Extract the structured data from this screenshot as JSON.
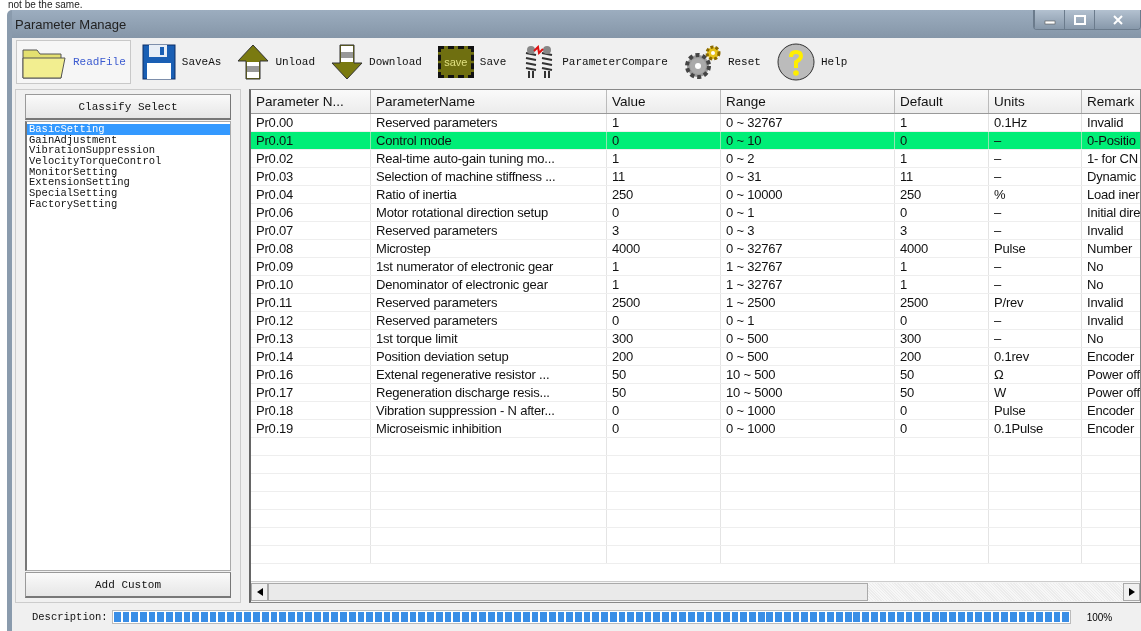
{
  "background_text": "not be the same.",
  "window": {
    "title": "Parameter Manage"
  },
  "toolbar": [
    {
      "kind": "folder",
      "label": "ReadFile",
      "selected": true
    },
    {
      "kind": "floppy",
      "label": "SaveAs",
      "selected": false
    },
    {
      "kind": "up",
      "label": "Unload",
      "selected": false
    },
    {
      "kind": "down",
      "label": "Download",
      "selected": false
    },
    {
      "kind": "chip",
      "label": "Save",
      "chip_text": "save",
      "selected": false
    },
    {
      "kind": "compare",
      "label": "ParameterCompare",
      "selected": false
    },
    {
      "kind": "gears",
      "label": "Reset",
      "selected": false
    },
    {
      "kind": "help",
      "label": "Help",
      "selected": false
    }
  ],
  "sidebar": {
    "header": "Classify Select",
    "items": [
      {
        "label": "BasicSetting",
        "selected": true
      },
      {
        "label": "GainAdjustment",
        "selected": false
      },
      {
        "label": "VibrationSuppression",
        "selected": false
      },
      {
        "label": "VelocityTorqueControl",
        "selected": false
      },
      {
        "label": "MonitorSetting",
        "selected": false
      },
      {
        "label": "ExtensionSetting",
        "selected": false
      },
      {
        "label": "SpecialSetting",
        "selected": false
      },
      {
        "label": "FactorySetting",
        "selected": false
      }
    ],
    "button": "Add Custom"
  },
  "table": {
    "columns": [
      "Parameter N...",
      "ParameterName",
      "Value",
      "Range",
      "Default",
      "Units",
      "Remark"
    ],
    "rows": [
      {
        "cells": [
          "Pr0.00",
          "Reserved parameters",
          "1",
          "0 ~ 32767",
          "1",
          "0.1Hz",
          "Invalid"
        ],
        "selected": false
      },
      {
        "cells": [
          "Pr0.01",
          "Control mode",
          "0",
          "0 ~ 10",
          "0",
          "–",
          "0-Positio"
        ],
        "selected": true
      },
      {
        "cells": [
          "Pr0.02",
          "Real-time auto-gain tuning mo...",
          "1",
          "0 ~ 2",
          "1",
          "–",
          "1- for CN"
        ],
        "selected": false
      },
      {
        "cells": [
          "Pr0.03",
          "Selection of machine stiffness ...",
          "11",
          "0 ~ 31",
          "11",
          "–",
          "Dynamic"
        ],
        "selected": false
      },
      {
        "cells": [
          "Pr0.04",
          "Ratio of inertia",
          "250",
          "0 ~ 10000",
          "250",
          "%",
          "Load iner"
        ],
        "selected": false
      },
      {
        "cells": [
          "Pr0.06",
          "Motor rotational direction setup",
          "0",
          "0 ~ 1",
          "0",
          "–",
          "Initial dire"
        ],
        "selected": false
      },
      {
        "cells": [
          "Pr0.07",
          "Reserved parameters",
          "3",
          "0 ~ 3",
          "3",
          "–",
          "Invalid"
        ],
        "selected": false
      },
      {
        "cells": [
          "Pr0.08",
          "Microstep",
          "4000",
          "0 ~ 32767",
          "4000",
          "Pulse",
          "Number"
        ],
        "selected": false
      },
      {
        "cells": [
          "Pr0.09",
          "1st numerator of electronic gear",
          "1",
          "1 ~ 32767",
          "1",
          "–",
          "No"
        ],
        "selected": false
      },
      {
        "cells": [
          "Pr0.10",
          "Denominator of electronic gear",
          "1",
          "1 ~ 32767",
          "1",
          "–",
          "No"
        ],
        "selected": false
      },
      {
        "cells": [
          "Pr0.11",
          "Reserved parameters",
          "2500",
          "1 ~ 2500",
          "2500",
          "P/rev",
          "Invalid"
        ],
        "selected": false
      },
      {
        "cells": [
          "Pr0.12",
          "Reserved parameters",
          "0",
          "0 ~ 1",
          "0",
          "–",
          "Invalid"
        ],
        "selected": false
      },
      {
        "cells": [
          "Pr0.13",
          "1st torque limit",
          "300",
          "0 ~ 500",
          "300",
          "–",
          "No"
        ],
        "selected": false
      },
      {
        "cells": [
          "Pr0.14",
          "Position deviation setup",
          "200",
          "0 ~ 500",
          "200",
          "0.1rev",
          "Encoder"
        ],
        "selected": false
      },
      {
        "cells": [
          "Pr0.16",
          "Extenal regenerative resistor ...",
          "50",
          "10 ~ 500",
          "50",
          "Ω",
          "Power off"
        ],
        "selected": false
      },
      {
        "cells": [
          "Pr0.17",
          "Regeneration discharge resis...",
          "50",
          "10 ~ 5000",
          "50",
          "W",
          "Power off"
        ],
        "selected": false
      },
      {
        "cells": [
          "Pr0.18",
          "Vibration suppression - N after...",
          "0",
          "0 ~ 1000",
          "0",
          "Pulse",
          "Encoder"
        ],
        "selected": false
      },
      {
        "cells": [
          "Pr0.19",
          "Microseismic inhibition",
          "0",
          "0 ~ 1000",
          "0",
          "0.1Pulse",
          "Encoder"
        ],
        "selected": false
      }
    ]
  },
  "description": {
    "label": "Description:",
    "level": 1,
    "reading": "100%"
  }
}
